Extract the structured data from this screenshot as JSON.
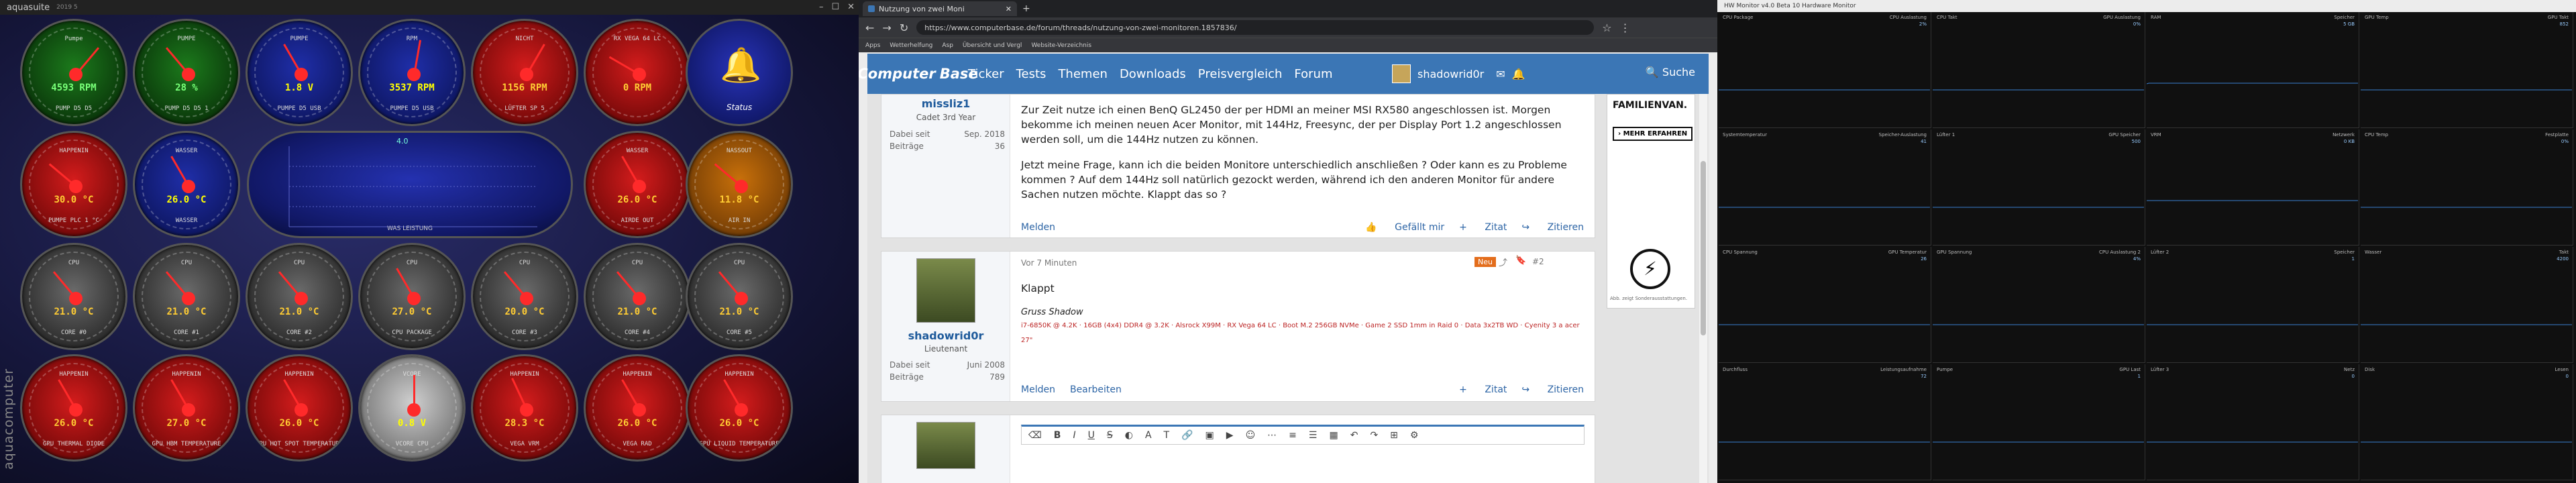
{
  "aquasuite": {
    "window_title": "aquasuite",
    "version": "2019 5",
    "brand": "aquacomputer",
    "gauges": [
      {
        "top": "Pumpe",
        "val": "4593 RPM",
        "sub": "PUMP D5 D5",
        "cls": "g-green",
        "ang": 40
      },
      {
        "top": "PUMPE",
        "val": "28 %",
        "sub": "PUMP D5 D5 1",
        "cls": "g-green",
        "ang": -40
      },
      {
        "top": "PUMPE",
        "val": "1.8 V",
        "sub": "PUMPE D5 USB",
        "cls": "g-blue",
        "ang": -30
      },
      {
        "top": "RPM",
        "val": "3537 RPM",
        "sub": "PUMPE D5 USB",
        "cls": "g-blue",
        "ang": 10
      },
      {
        "top": "NICHT",
        "val": "1156 RPM",
        "sub": "LÜFTER SP 5",
        "cls": "g-red",
        "ang": 30
      },
      {
        "top": "RX VEGA 64 LC",
        "val": "0 RPM",
        "sub": "",
        "cls": "g-red",
        "ang": -60
      },
      {
        "top": "HAPPENIN",
        "val": "30.0 °C",
        "sub": "PUMPE PLC 1 °C",
        "cls": "g-red",
        "ang": -50
      },
      {
        "top": "WASSER",
        "val": "26.0 °C",
        "sub": "WASSER",
        "cls": "g-blue",
        "ang": -30
      },
      {
        "top": "WASSER",
        "val": "26.0 °C",
        "sub": "AIRDE OUT",
        "cls": "g-red",
        "ang": -30
      },
      {
        "top": "NASSOUT",
        "val": "11.8 °C",
        "sub": "AIR IN",
        "cls": "g-orange",
        "ang": -50
      },
      {
        "top": "CPU",
        "val": "21.0 °C",
        "sub": "CORE #0",
        "cls": "g-gray",
        "ang": -40
      },
      {
        "top": "CPU",
        "val": "21.0 °C",
        "sub": "CORE #1",
        "cls": "g-gray",
        "ang": -40
      },
      {
        "top": "CPU",
        "val": "21.0 °C",
        "sub": "CORE #2",
        "cls": "g-gray",
        "ang": -40
      },
      {
        "top": "CPU",
        "val": "27.0 °C",
        "sub": "CPU PACKAGE",
        "cls": "g-gray",
        "ang": -30
      },
      {
        "top": "CPU",
        "val": "20.0 °C",
        "sub": "CORE #3",
        "cls": "g-gray",
        "ang": -40
      },
      {
        "top": "CPU",
        "val": "21.0 °C",
        "sub": "CORE #4",
        "cls": "g-gray",
        "ang": -40
      },
      {
        "top": "CPU",
        "val": "21.0 °C",
        "sub": "CORE #5",
        "cls": "g-gray",
        "ang": -40
      },
      {
        "top": "HAPPENIN",
        "val": "26.0 °C",
        "sub": "GPU THERMAL DIODE",
        "cls": "g-red",
        "ang": -30
      },
      {
        "top": "HAPPENIN",
        "val": "27.0 °C",
        "sub": "GPU HBM TEMPERATURE",
        "cls": "g-red",
        "ang": -30
      },
      {
        "top": "HAPPENIN",
        "val": "26.0 °C",
        "sub": "GPU HOT SPOT TEMPERATURE",
        "cls": "g-red",
        "ang": -30
      },
      {
        "top": "VCORE",
        "val": "0.8 V",
        "sub": "VCORE CPU",
        "cls": "g-white",
        "ang": 0
      },
      {
        "top": "HAPPENIN",
        "val": "28.3 °C",
        "sub": "VEGA VRM",
        "cls": "g-red",
        "ang": -25
      },
      {
        "top": "HAPPENIN",
        "val": "26.0 °C",
        "sub": "VEGA RAD",
        "cls": "g-red",
        "ang": -30
      },
      {
        "top": "HAPPENIN",
        "val": "26.0 °C",
        "sub": "GPU LIQUID TEMPERATURE",
        "cls": "g-red",
        "ang": -30
      }
    ],
    "status_label": "Status",
    "chart_label": "WAS LEISTUNG",
    "chart_value": "4.0"
  },
  "browser": {
    "tab_title": "Nutzung von zwei Moni",
    "url": "https://www.computerbase.de/forum/threads/nutzung-von-zwei-monitoren.1857836/",
    "bookmarks": [
      "Apps",
      "Wetterhelfung",
      "Asp",
      "Übersicht und Vergl",
      "Website-Verzeichnis"
    ],
    "site_logo_1": "Computer",
    "site_logo_2": "Base",
    "nav": [
      "Ticker",
      "Tests",
      "Themen",
      "Downloads",
      "Preisvergleich",
      "Forum"
    ],
    "username": "shadowrid0r",
    "search": "Suche",
    "posts": [
      {
        "user": "missliz1",
        "rank": "Cadet 3rd Year",
        "joined_label": "Dabei seit",
        "joined": "Sep. 2018",
        "count_label": "Beiträge",
        "count": "36",
        "text1": "Zur Zeit nutze ich einen BenQ GL2450 der per HDMI an meiner MSI RX580 angeschlossen ist. Morgen bekomme ich meinen neuen Acer Monitor, mit 144Hz, Freesync, der per Display Port 1.2 angeschlossen werden soll, um die 144Hz nutzen zu können.",
        "text2": "Jetzt meine Frage, kann ich die beiden Monitore unterschiedlich anschließen ? Oder kann es zu Probleme kommen ? Auf dem 144Hz soll natürlich gezockt werden, während ich den anderen Monitor für andere Sachen nutzen möchte. Klappt das so ?",
        "foot_left": "Melden",
        "foot_r1": "Gefällt mir",
        "foot_r2": "Zitat",
        "foot_r3": "Zitieren"
      },
      {
        "user": "shadowrid0r",
        "rank": "Lieutenant",
        "joined_label": "Dabei seit",
        "joined": "Juni 2008",
        "count_label": "Beiträge",
        "count": "789",
        "time": "Vor 7 Minuten",
        "badge": "Neu",
        "num": "#2",
        "text1": "Klappt",
        "sig": "Gruss Shadow",
        "specs": "i7-6850K @ 4.2K · 16GB (4x4) DDR4 @ 3.2K · Alsrock X99M · RX Vega 64 LC · Boot M.2 256GB NVMe · Game 2 SSD 1mm in Raid 0 · Data 3x2TB WD · Cyenity 3 a acer 27\"",
        "foot_left": "Melden",
        "foot_left2": "Bearbeiten",
        "foot_r2": "Zitat",
        "foot_r3": "Zitieren"
      }
    ],
    "ad_title": "FAMILIENVAN.",
    "ad_btn": "MEHR ERFAHREN",
    "ad_small": "Abb. zeigt Sonderausstattungen."
  },
  "monitor": {
    "window_title": "HW Monitor v4.0 Beta 10 Hardware Monitor",
    "tiles": [
      {
        "l": "CPU Package",
        "r": "CPU Auslastung",
        "v": "2%"
      },
      {
        "l": "CPU Takt",
        "r": "GPU Auslastung",
        "v": "0%"
      },
      {
        "l": "RAM",
        "r": "Speicher",
        "v": "5 GB"
      },
      {
        "l": "GPU Temp",
        "r": "GPU Takt",
        "v": "852"
      },
      {
        "l": "Systemtemperatur",
        "r": "Speicher-Auslastung",
        "v": "41"
      },
      {
        "l": "Lüfter 1",
        "r": "GPU Speicher",
        "v": "500"
      },
      {
        "l": "VRM",
        "r": "Netzwerk",
        "v": "0 KB"
      },
      {
        "l": "CPU Temp",
        "r": "Festplatte",
        "v": "0%"
      },
      {
        "l": "CPU Spannung",
        "r": "GPU Temperatur",
        "v": "26"
      },
      {
        "l": "GPU Spannung",
        "r": "CPU Auslastung 2",
        "v": "4%"
      },
      {
        "l": "Lüfter 2",
        "r": "Speicher",
        "v": "1"
      },
      {
        "l": "Wasser",
        "r": "Takt",
        "v": "4200"
      },
      {
        "l": "Durchfluss",
        "r": "Leistungsaufnahme",
        "v": "72"
      },
      {
        "l": "Pumpe",
        "r": "GPU Last",
        "v": "1"
      },
      {
        "l": "Lüfter 3",
        "r": "Netz",
        "v": "0"
      },
      {
        "l": "Disk",
        "r": "Lesen",
        "v": "0"
      }
    ]
  }
}
